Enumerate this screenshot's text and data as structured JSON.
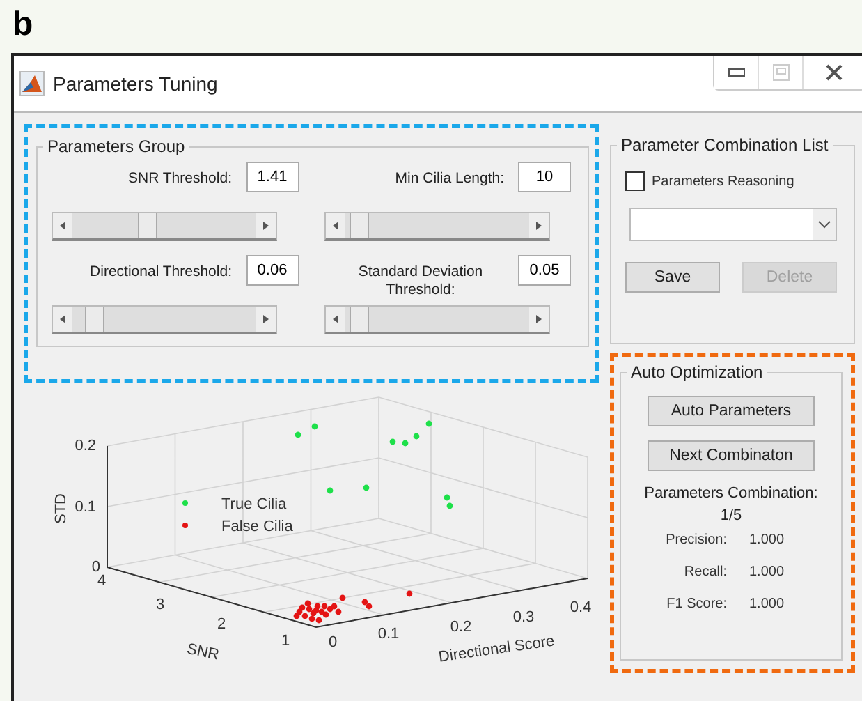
{
  "figure_label": "b",
  "window": {
    "title": "Parameters Tuning"
  },
  "parameters_group": {
    "title": "Parameters Group",
    "fields": [
      {
        "label": "SNR Threshold:",
        "value": "1.41",
        "level": 0.4
      },
      {
        "label": "Min Cilia Length:",
        "value": "10",
        "level": 0.03
      },
      {
        "label": "Directional Threshold:",
        "value": "0.06",
        "level": 0.08
      },
      {
        "label": "Standard Deviation Threshold:",
        "value": "0.05",
        "level": 0.03
      }
    ]
  },
  "combination_list": {
    "title": "Parameter Combination List",
    "reasoning": {
      "label": "Parameters Reasoning",
      "checked": false
    },
    "buttons": [
      {
        "label": "Save",
        "disabled": false
      },
      {
        "label": "Delete",
        "disabled": true
      }
    ]
  },
  "auto_optimization": {
    "title": "Auto Optimization",
    "buttons": [
      "Auto Parameters",
      "Next Combinaton"
    ],
    "combination_label": "Parameters Combination:",
    "combination_value": "1/5",
    "metrics": [
      {
        "label": "Precision:",
        "value": "1.000"
      },
      {
        "label": "Recall:",
        "value": "1.000"
      },
      {
        "label": "F1 Score:",
        "value": "1.000"
      }
    ]
  },
  "plot": {
    "zlabel": "STD",
    "ylabel": "SNR",
    "xlabel": "Directional Score",
    "z_ticks": [
      "0.2",
      "0.1",
      "0"
    ],
    "y_ticks": [
      "4",
      "3",
      "2",
      "1"
    ],
    "x_ticks": [
      "0",
      "0.1",
      "0.2",
      "0.3",
      "0.4"
    ],
    "legend": [
      {
        "label": "True Cilia",
        "color": "#1ee04a"
      },
      {
        "label": "False Cilia",
        "color": "#e41414"
      }
    ]
  }
}
